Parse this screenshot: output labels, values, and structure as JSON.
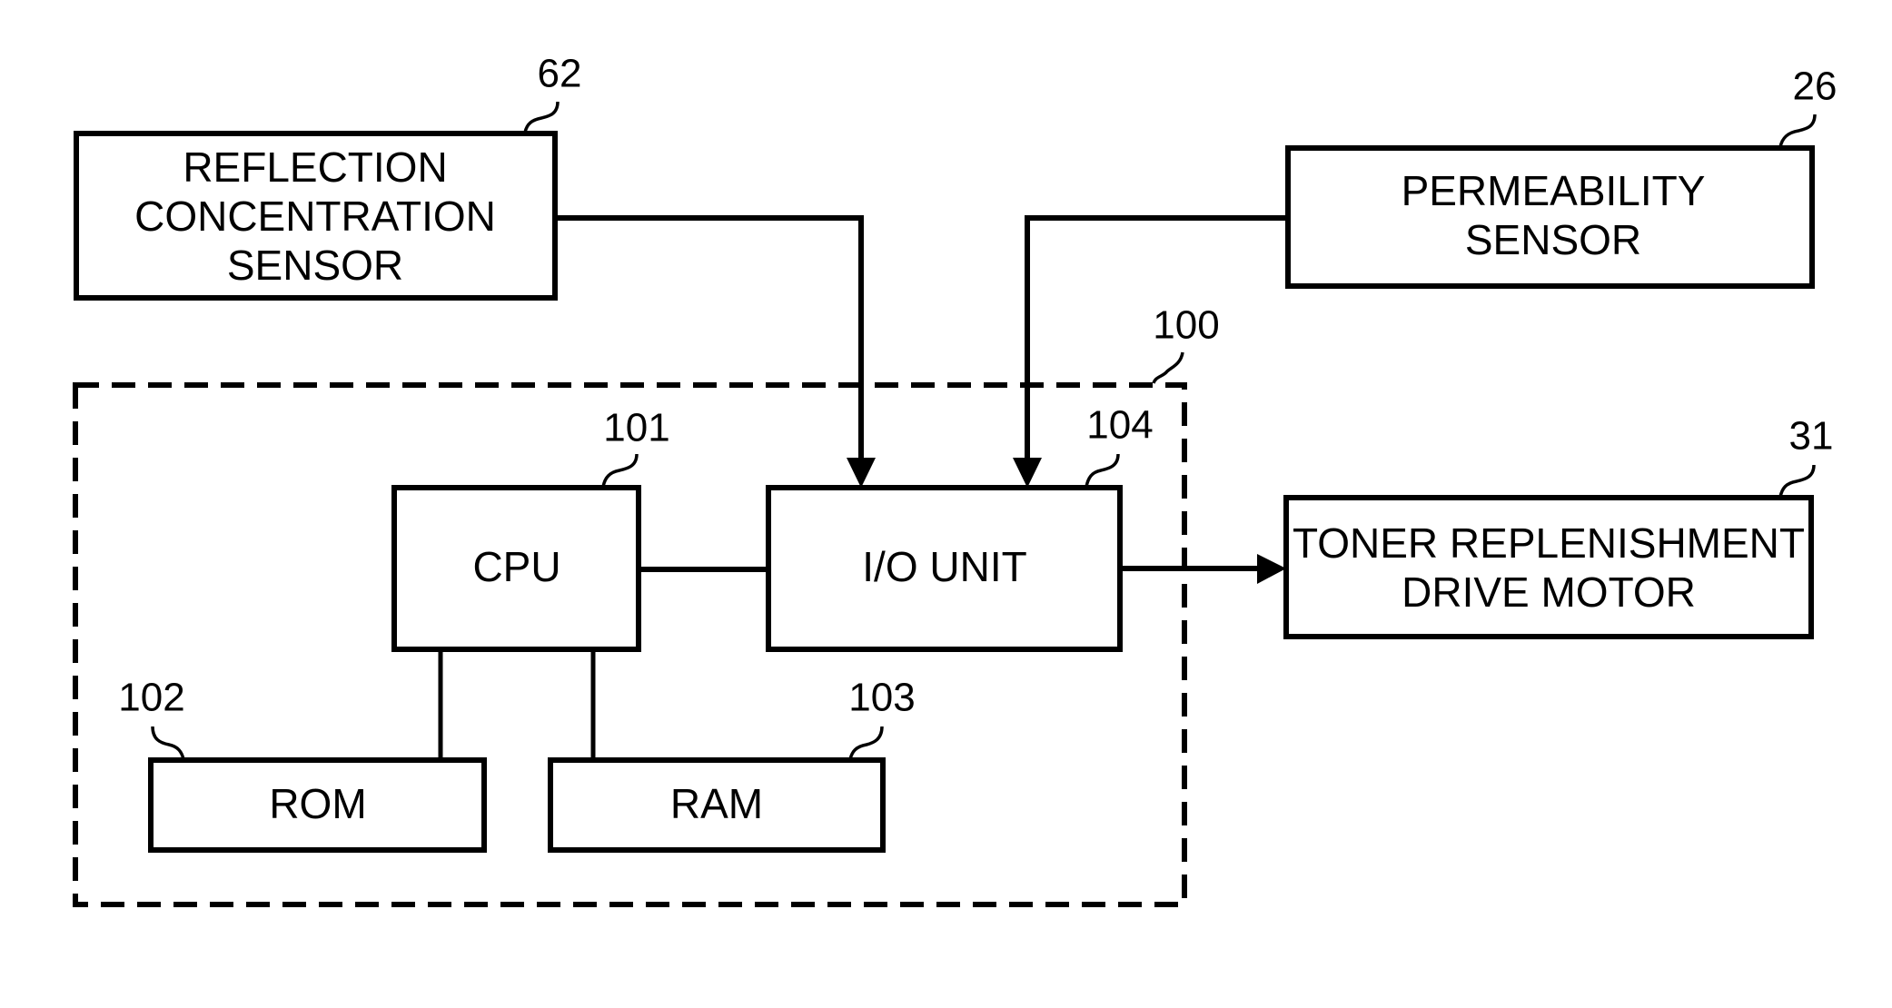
{
  "diagram": {
    "type": "block-diagram",
    "controller": {
      "ref": "100",
      "blocks": {
        "cpu": {
          "ref": "101",
          "label": "CPU"
        },
        "rom": {
          "ref": "102",
          "label": "ROM"
        },
        "ram": {
          "ref": "103",
          "label": "RAM"
        },
        "io_unit": {
          "ref": "104",
          "label": "I/O UNIT"
        }
      }
    },
    "reflection_sensor": {
      "ref": "62",
      "lines": [
        "REFLECTION",
        "CONCENTRATION",
        "SENSOR"
      ]
    },
    "permeability_sensor": {
      "ref": "26",
      "lines": [
        "PERMEABILITY",
        "SENSOR"
      ]
    },
    "toner_motor": {
      "ref": "31",
      "lines": [
        "TONER REPLENISHMENT",
        "DRIVE MOTOR"
      ]
    },
    "connections": [
      {
        "from": "REFLECTION CONCENTRATION SENSOR",
        "to": "I/O UNIT",
        "directed": true
      },
      {
        "from": "PERMEABILITY SENSOR",
        "to": "I/O UNIT",
        "directed": true
      },
      {
        "from": "I/O UNIT",
        "to": "TONER REPLENISHMENT DRIVE MOTOR",
        "directed": true
      },
      {
        "from": "CPU",
        "to": "I/O UNIT",
        "directed": false
      },
      {
        "from": "CPU",
        "to": "ROM",
        "directed": false
      },
      {
        "from": "CPU",
        "to": "RAM",
        "directed": false
      }
    ]
  }
}
